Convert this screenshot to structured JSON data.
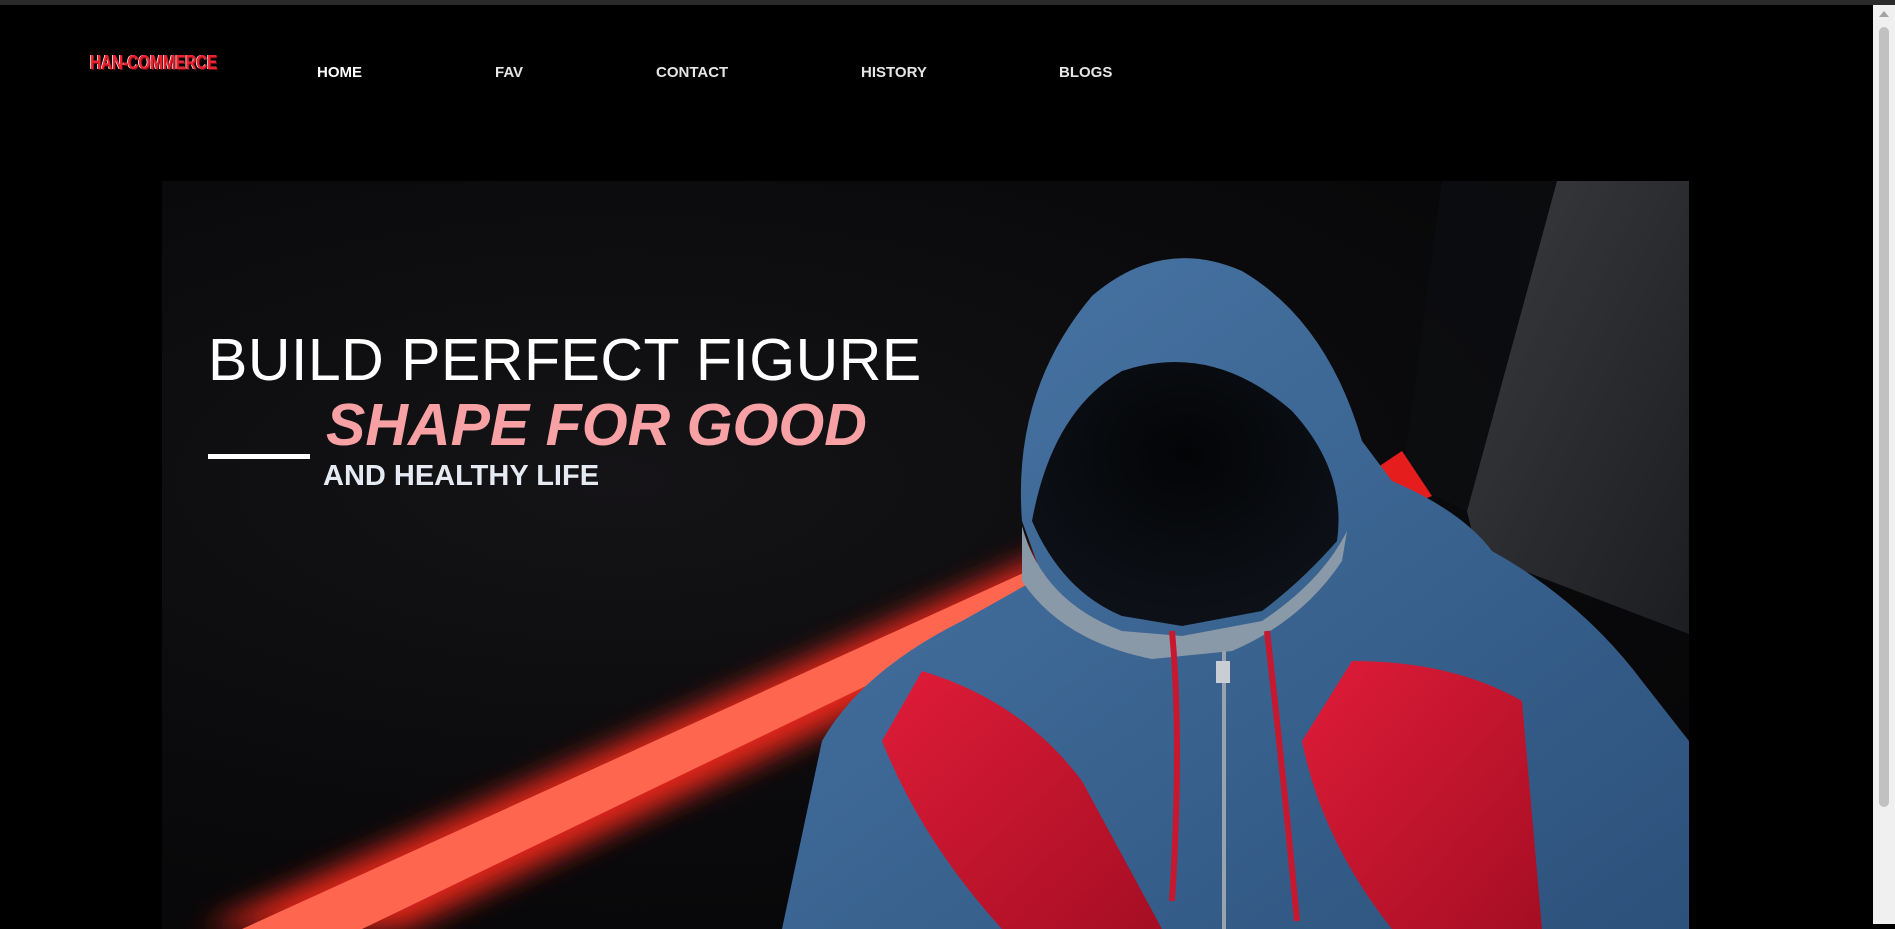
{
  "brand": {
    "logo_text": "HAN-COMMERCE"
  },
  "nav": {
    "items": [
      {
        "label": "HOME",
        "active": true
      },
      {
        "label": "FAV",
        "active": false
      },
      {
        "label": "CONTACT",
        "active": false
      },
      {
        "label": "HISTORY",
        "active": false
      },
      {
        "label": "BLOGS",
        "active": false
      }
    ]
  },
  "hero": {
    "line1": "BUILD PERFECT FIGURE",
    "line2": "SHAPE FOR GOOD",
    "line3": "AND HEALTHY LIFE",
    "image_icon": "hoodie-image"
  },
  "colors": {
    "background": "#000000",
    "accent_pink": "#f7a1a4",
    "logo_red": "#e8232f",
    "hoodie_blue": "#3c6796",
    "hoodie_red": "#cc1530",
    "neon_red": "#ff3a2e"
  }
}
